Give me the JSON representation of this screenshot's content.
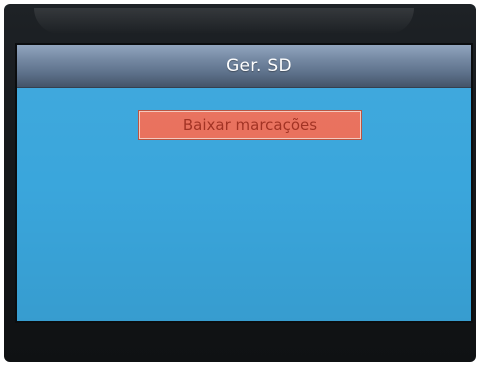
{
  "screen": {
    "title": "Ger. SD"
  },
  "menu": {
    "items": [
      {
        "label": "Baixar marcações",
        "selected": true
      }
    ]
  },
  "colors": {
    "screen_background": "#3aa6dc",
    "title_bar": "#6f849f",
    "selected_item": "#e9705c",
    "selected_item_text": "#9a2a1b",
    "bezel": "#16191c"
  }
}
